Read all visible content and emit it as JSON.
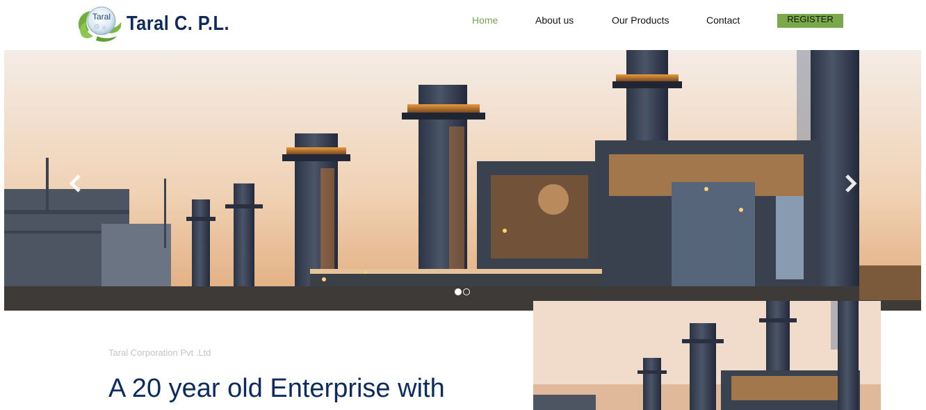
{
  "header": {
    "brand": "Taral C. P.L.",
    "logo_badge": "Taral",
    "nav": [
      {
        "label": "Home",
        "active": true
      },
      {
        "label": "About us",
        "active": false
      },
      {
        "label": "Our Products",
        "active": false
      },
      {
        "label": "Contact",
        "active": false
      }
    ],
    "register_label": "REGISTER"
  },
  "carousel": {
    "image": "industrial-plant-sunset",
    "prev_icon": "chevron-left-icon",
    "next_icon": "chevron-right-icon",
    "slide_count": 2,
    "active_slide": 1
  },
  "intro": {
    "company": "Taral Corporation Pvt .Ltd",
    "headline": "A 20 year old Enterprise with"
  },
  "colors": {
    "accent": "#79a94a",
    "nav_active": "#7aa34c",
    "headline": "#0d2b61",
    "brand": "#0f2a5c"
  }
}
